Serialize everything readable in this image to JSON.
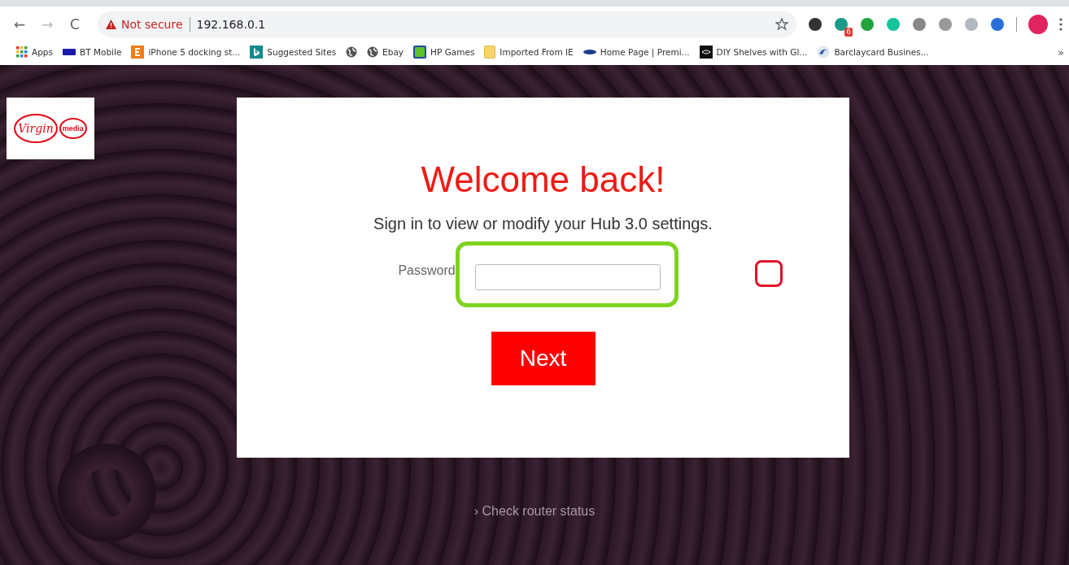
{
  "browser": {
    "nav": [
      "←",
      "→",
      "C"
    ],
    "security_label": "Not secure",
    "url": "192.168.0.1",
    "extension_badge": "6",
    "bookmarks": [
      {
        "label": "Apps"
      },
      {
        "label": "BT Mobile"
      },
      {
        "label": "iPhone 5 docking st..."
      },
      {
        "label": "Suggested Sites"
      },
      {
        "kind": "icon_only"
      },
      {
        "label": "Ebay"
      },
      {
        "label": "HP Games"
      },
      {
        "label": "Imported From IE"
      },
      {
        "label": "Home Page | Premi..."
      },
      {
        "label": "DIY Shelves with Gl..."
      },
      {
        "label": "Barclaycard Busines..."
      }
    ],
    "overflow": "»"
  },
  "logo": {
    "word": "Virgin",
    "sub": "media"
  },
  "login": {
    "title": "Welcome back!",
    "subtitle": "Sign in to view or modify your Hub 3.0 settings.",
    "password_label": "Password",
    "next_button": "Next"
  },
  "footer_link": {
    "chevron": "›",
    "label": "Check router status"
  }
}
